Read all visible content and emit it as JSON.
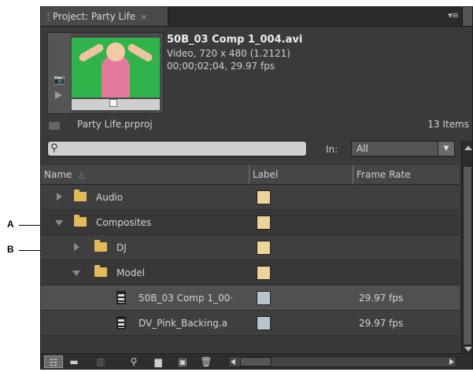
{
  "panel": {
    "tab_label": "Project: Party Life",
    "tab_close": "×",
    "menu_glyph": "▾≡"
  },
  "preview": {
    "clip_name": "50B_03 Comp 1_004.avi",
    "clip_info": "Video, 720 x 480 (1.2121)",
    "clip_time": "00;00;02;04, 29.97 fps",
    "camera_glyph": "📷"
  },
  "project": {
    "file_name": "Party Life.prproj",
    "item_count": "13 Items"
  },
  "search": {
    "placeholder": "",
    "search_glyph": "⚲",
    "in_label": "In:",
    "in_value": "All",
    "in_arrow": "▼"
  },
  "table": {
    "headers": {
      "name": "Name",
      "label": "Label",
      "frame_rate": "Frame Rate"
    },
    "sort_glyph": "△",
    "rows": [
      {
        "name": "Audio",
        "type": "folder",
        "expanded": false,
        "indent": 0,
        "label_color": "#edd39c",
        "frame_rate": ""
      },
      {
        "name": "Composites",
        "type": "folder",
        "expanded": true,
        "indent": 0,
        "label_color": "#edd39c",
        "frame_rate": ""
      },
      {
        "name": "DJ",
        "type": "folder",
        "expanded": false,
        "indent": 1,
        "label_color": "#edd39c",
        "frame_rate": ""
      },
      {
        "name": "Model",
        "type": "folder",
        "expanded": true,
        "indent": 1,
        "label_color": "#edd39c",
        "frame_rate": ""
      },
      {
        "name": "50B_03 Comp 1_00·",
        "type": "clip",
        "indent": 2,
        "label_color": "#b8c4cc",
        "frame_rate": "29.97 fps"
      },
      {
        "name": "DV_Pink_Backing.a",
        "type": "clip",
        "indent": 2,
        "label_color": "#b8c4cc",
        "frame_rate": "29.97 fps"
      }
    ]
  },
  "toolbar": {
    "list_view_glyph": "☷",
    "icon_view_glyph": "▬",
    "automate_glyph": "▥",
    "find_glyph": "⚲",
    "new_bin_glyph": "▆",
    "new_item_glyph": "▣",
    "delete_glyph": "🗑"
  },
  "callouts": {
    "a": "A",
    "b": "B"
  },
  "colors": {
    "panel_bg": "#3a3a3a",
    "folder": "#e3b95a",
    "selected_row": "#505050"
  }
}
